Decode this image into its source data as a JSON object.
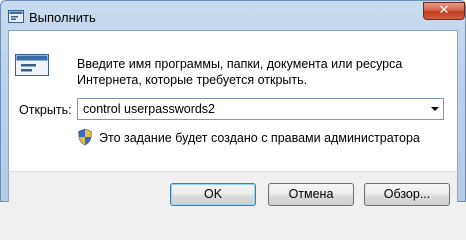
{
  "window": {
    "title": "Выполнить",
    "close_label": "✕"
  },
  "dialog": {
    "description_line1": "Введите имя программы, папки, документа или ресурса",
    "description_line2": "Интернета, которые требуется открыть.",
    "open_label": "Открыть:",
    "open_value": "control userpasswords2",
    "admin_note": "Это задание будет создано с правами администратора"
  },
  "buttons": {
    "ok": "OK",
    "cancel": "Отмена",
    "browse": "Обзор..."
  },
  "icons": {
    "app": "run-icon",
    "shield": "uac-shield-icon"
  }
}
